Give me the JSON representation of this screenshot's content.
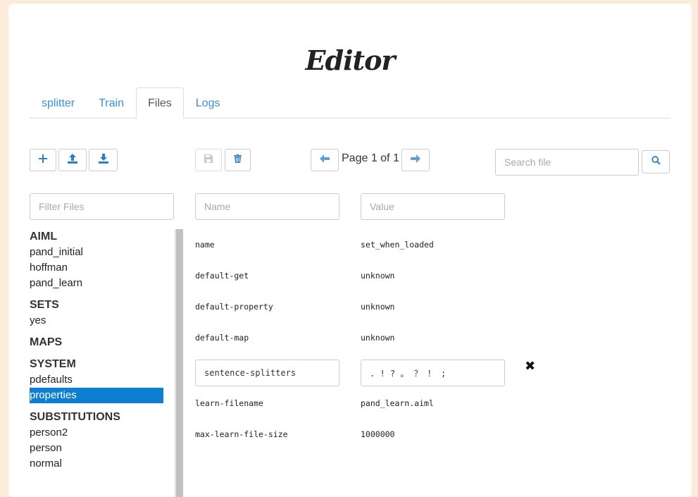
{
  "title": "Editor",
  "tabs": [
    {
      "label": "splitter"
    },
    {
      "label": "Train"
    },
    {
      "label": "Files"
    },
    {
      "label": "Logs"
    }
  ],
  "active_tab": "Files",
  "icons": {
    "new": "plus-icon",
    "upload": "upload-icon",
    "download": "download-icon",
    "save": "floppy-icon",
    "delete": "trash-icon",
    "prev": "arrow-left-icon",
    "next": "arrow-right-icon",
    "search": "search-icon",
    "remove": "close-icon"
  },
  "pager": {
    "text": "Page 1 of 1"
  },
  "search": {
    "placeholder": "Search file"
  },
  "filter": {
    "placeholder": "Filter Files"
  },
  "new_entry": {
    "name_placeholder": "Name",
    "value_placeholder": "Value"
  },
  "file_tree": [
    {
      "group": "AIML",
      "items": [
        "pand_initial",
        "hoffman",
        "pand_learn"
      ]
    },
    {
      "group": "SETS",
      "items": [
        "yes"
      ]
    },
    {
      "group": "MAPS",
      "items": []
    },
    {
      "group": "SYSTEM",
      "items": [
        "pdefaults",
        "properties"
      ]
    },
    {
      "group": "SUBSTITUTIONS",
      "items": [
        "person2",
        "person",
        "normal"
      ]
    }
  ],
  "selected_file": "properties",
  "properties": [
    {
      "name": "name",
      "value": "set_when_loaded"
    },
    {
      "name": "default-get",
      "value": "unknown"
    },
    {
      "name": "default-property",
      "value": "unknown"
    },
    {
      "name": "default-map",
      "value": "unknown"
    },
    {
      "name": "sentence-splitters",
      "value": ". ! ? 。 ？ ！ ;",
      "editing": true
    },
    {
      "name": "learn-filename",
      "value": "pand_learn.aiml"
    },
    {
      "name": "max-learn-file-size",
      "value": "1000000"
    }
  ],
  "colors": {
    "accent": "#0d7fd1",
    "link": "#3a8fd6",
    "background": "#fdebd9"
  }
}
